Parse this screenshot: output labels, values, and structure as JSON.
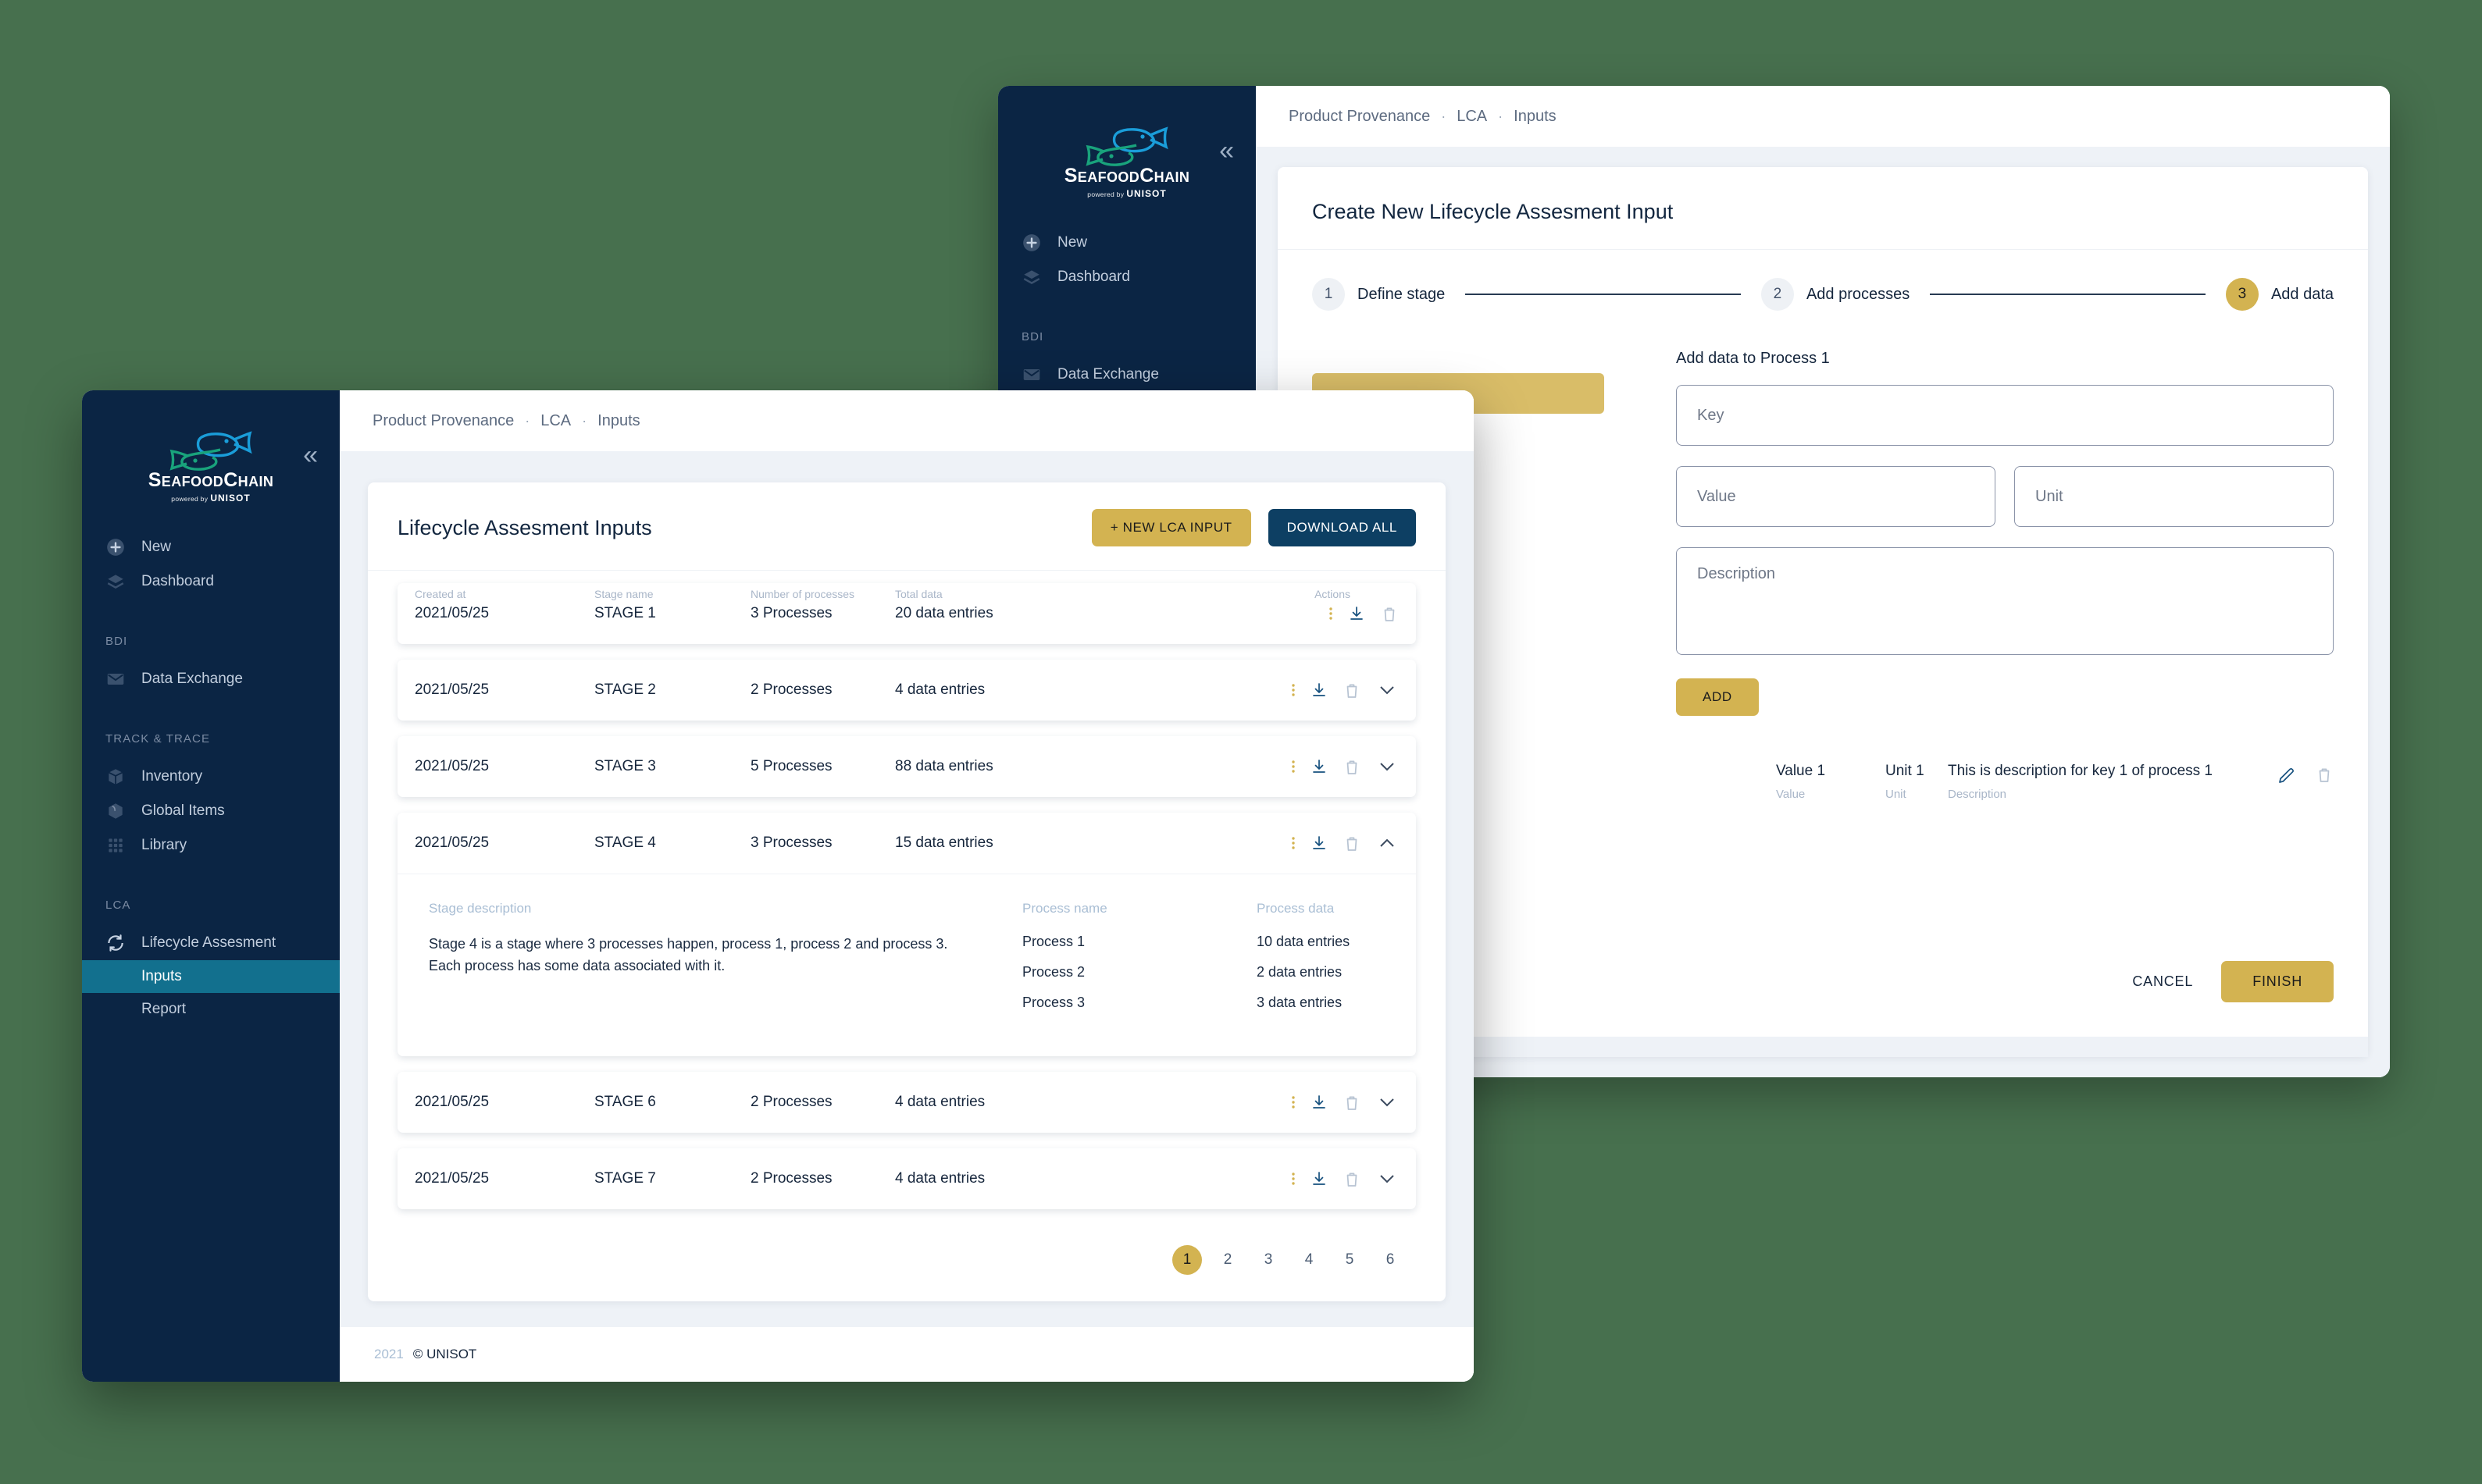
{
  "theme": {
    "canvas_green": "#47704e",
    "sidebar_navy": "#0b2544",
    "accent_gold": "#d3b351",
    "accent_navy": "#0d3f63",
    "active_teal": "#12708e"
  },
  "brand": {
    "name_part1": "S",
    "name_part2": "EAFOOD",
    "name_part3": "C",
    "name_part4": "HAIN",
    "powered_by": "powered by",
    "parent": "UNISOT"
  },
  "sidebar": {
    "primary": [
      {
        "label": "New",
        "icon": "plus-circle-icon"
      },
      {
        "label": "Dashboard",
        "icon": "layers-icon"
      }
    ],
    "groups": [
      {
        "label": "BDI",
        "items": [
          {
            "label": "Data Exchange",
            "icon": "envelope-icon"
          }
        ]
      },
      {
        "label": "TRACK & TRACE",
        "items": [
          {
            "label": "Inventory",
            "icon": "box-icon"
          },
          {
            "label": "Global Items",
            "icon": "cube-icon"
          },
          {
            "label": "Library",
            "icon": "grid-icon"
          }
        ]
      },
      {
        "label": "LCA",
        "items": [
          {
            "label": "Lifecycle Assesment",
            "icon": "refresh-icon"
          }
        ],
        "subitems": [
          {
            "label": "Inputs",
            "active": true
          },
          {
            "label": "Report",
            "active": false
          }
        ]
      }
    ]
  },
  "breadcrumb": {
    "items": [
      "Product Provenance",
      "LCA",
      "Inputs"
    ],
    "separator": "·"
  },
  "list_page": {
    "title": "Lifecycle Assesment Inputs",
    "new_button": "+ NEW LCA INPUT",
    "download_button": "DOWNLOAD ALL",
    "columns": [
      "Created at",
      "Stage name",
      "Number of processes",
      "Total data",
      "Actions"
    ],
    "rows": [
      {
        "created": "2021/05/25",
        "stage": "STAGE 1",
        "processes": "3 Processes",
        "total": "20 data entries",
        "expanded": false,
        "first": true
      },
      {
        "created": "2021/05/25",
        "stage": "STAGE 2",
        "processes": "2 Processes",
        "total": "4 data entries",
        "expanded": false,
        "first": false
      },
      {
        "created": "2021/05/25",
        "stage": "STAGE 3",
        "processes": "5 Processes",
        "total": "88 data entries",
        "expanded": false,
        "first": false
      },
      {
        "created": "2021/05/25",
        "stage": "STAGE 4",
        "processes": "3 Processes",
        "total": "15 data entries",
        "expanded": true,
        "first": false
      },
      {
        "created": "2021/05/25",
        "stage": "STAGE 6",
        "processes": "2 Processes",
        "total": "4 data entries",
        "expanded": false,
        "first": false
      },
      {
        "created": "2021/05/25",
        "stage": "STAGE 7",
        "processes": "2 Processes",
        "total": "4 data entries",
        "expanded": false,
        "first": false
      }
    ],
    "expanded_detail": {
      "stage_description_label": "Stage description",
      "stage_description": "Stage 4 is a stage where 3 processes happen, process 1, process 2 and process 3. Each process has some data associated with it.",
      "process_name_label": "Process name",
      "process_data_label": "Process data",
      "processes": [
        {
          "name": "Process 1",
          "data": "10 data entries"
        },
        {
          "name": "Process 2",
          "data": "2 data entries"
        },
        {
          "name": "Process 3",
          "data": "3 data entries"
        }
      ]
    },
    "pagination": {
      "pages": [
        "1",
        "2",
        "3",
        "4",
        "5",
        "6"
      ],
      "current": "1"
    }
  },
  "footer": {
    "year": "2021",
    "copyright": "© UNISOT"
  },
  "modal": {
    "title": "Create New Lifecycle Assesment Input",
    "steps": [
      {
        "num": "1",
        "label": "Define stage",
        "active": false
      },
      {
        "num": "2",
        "label": "Add processes",
        "active": false
      },
      {
        "num": "3",
        "label": "Add data",
        "active": true
      }
    ],
    "form_heading": "Add data to Process 1",
    "fields": {
      "key_placeholder": "Key",
      "value_placeholder": "Value",
      "unit_placeholder": "Unit",
      "description_placeholder": "Description"
    },
    "add_button": "ADD",
    "entries": [
      {
        "value": "Value 1",
        "value_label": "Value",
        "unit": "Unit 1",
        "unit_label": "Unit",
        "description": "This is description for key 1 of process 1",
        "description_label": "Description"
      }
    ],
    "cancel_button": "CANCEL",
    "finish_button": "FINISH"
  }
}
